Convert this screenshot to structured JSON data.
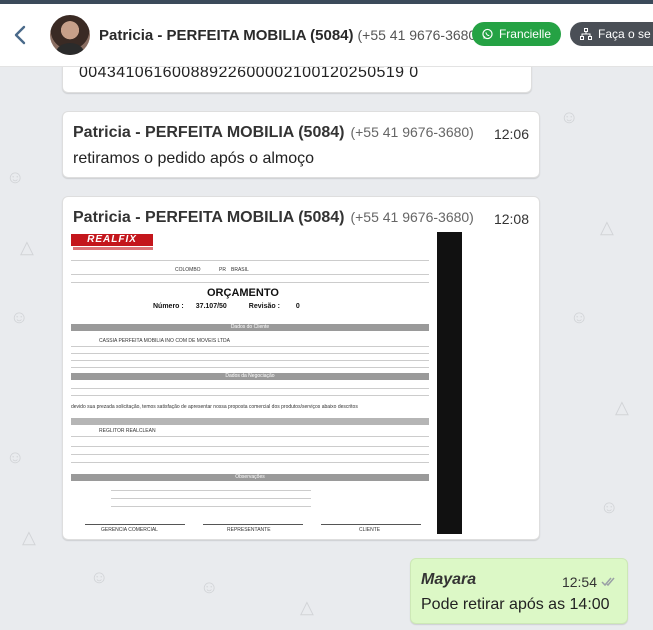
{
  "header": {
    "contact_name": "Patricia - PERFEITA MOBILIA (5084)",
    "contact_phone": "(+55 41 9676-3680)",
    "agent_button": "Francielle",
    "action_button": "Faça o se"
  },
  "messages": [
    {
      "id": "m1",
      "text": "00434106160088922600002100120250519 0"
    },
    {
      "id": "m2",
      "sender": "Patricia - PERFEITA MOBILIA (5084)",
      "phone": "(+55 41 9676-3680)",
      "time": "12:06",
      "text": "retiramos o pedido após o almoço"
    },
    {
      "id": "m3",
      "sender": "Patricia - PERFEITA MOBILIA (5084)",
      "phone": "(+55 41 9676-3680)",
      "time": "12:08",
      "document": {
        "logo": "REALFIX",
        "title": "ORÇAMENTO",
        "number_label": "Número :",
        "number": "37.107/50",
        "revision_label": "Revisão :",
        "revision": "0",
        "section_client": "Dados do Cliente",
        "section_negotiation": "Dados da Negociação",
        "section_obs": "Observações",
        "client_name": "CASSIA PERFEITA MOBILIA INO COM DE MOVEIS LTDA",
        "city": "COLOMBO",
        "state": "PR",
        "country": "BRASIL",
        "intro": "devido sua prezada solicitação, temos satisfação de apresentar nossa proposta comercial dos produtos/serviços abaixo descritos",
        "product": "REGLITOR REALCLEAN",
        "sign1": "GERENCIA COMERCIAL",
        "sign2": "REPRESENTANTE",
        "sign3": "CLIENTE"
      }
    },
    {
      "id": "m4",
      "sender": "Mayara",
      "time": "12:54",
      "text": "Pode retirar após as 14:00",
      "outgoing": true
    }
  ],
  "colors": {
    "outgoing_bubble": "#dcf8c6",
    "agent_pill": "#25a244",
    "action_pill": "#4a4f56",
    "logo_red": "#c4161c"
  }
}
